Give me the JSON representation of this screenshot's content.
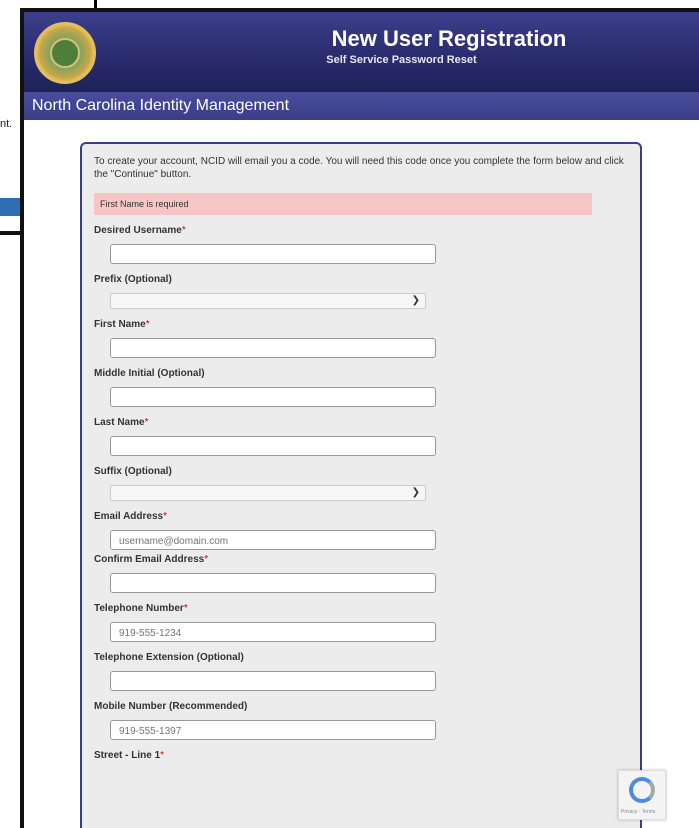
{
  "background": {
    "fragment_text": "nt."
  },
  "header": {
    "title": "New User Registration",
    "subtitle": "Self Service Password Reset",
    "seal_icon": "nc-state-seal-icon"
  },
  "subbar": {
    "text": "North Carolina Identity Management"
  },
  "form": {
    "intro": "To create your account, NCID will email you a code. You will need this code once you complete the form below and click the \"Continue\" button.",
    "error": "First Name is required",
    "required_marker": "*",
    "fields": {
      "username": {
        "label": "Desired Username",
        "value": ""
      },
      "prefix": {
        "label": "Prefix (Optional)",
        "value": ""
      },
      "first_name": {
        "label": "First Name",
        "value": ""
      },
      "middle_initial": {
        "label": "Middle Initial (Optional)",
        "value": ""
      },
      "last_name": {
        "label": "Last Name",
        "value": ""
      },
      "suffix": {
        "label": "Suffix (Optional)",
        "value": ""
      },
      "email": {
        "label": "Email Address",
        "placeholder": "username@domain.com"
      },
      "confirm_email": {
        "label": "Confirm Email Address",
        "value": ""
      },
      "telephone": {
        "label": "Telephone Number",
        "placeholder": "919-555-1234"
      },
      "extension": {
        "label": "Telephone Extension (Optional)",
        "value": ""
      },
      "mobile": {
        "label": "Mobile Number (Recommended)",
        "placeholder": "919-555-1397"
      },
      "street": {
        "label": "Street - Line 1"
      }
    }
  },
  "captcha": {
    "text": "Privacy - Terms",
    "icon": "recaptcha-icon"
  },
  "colors": {
    "header": "#2a2c6e",
    "panel_border": "#3a3d88",
    "error_bg": "#f6c6c6"
  }
}
